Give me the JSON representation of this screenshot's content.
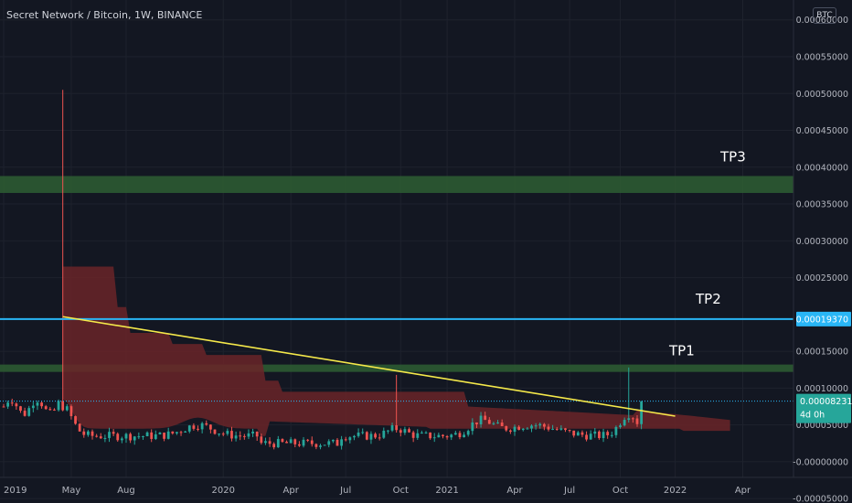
{
  "header": {
    "title": "Secret Network / Bitcoin, 1W, BINANCE",
    "currency": "BTC"
  },
  "chart_data": {
    "type": "candlestick",
    "yaxis": {
      "range": [
        -5.6e-05,
        0.000627
      ],
      "ticks": [
        "0.00060000",
        "0.00055000",
        "0.00050000",
        "0.00045000",
        "0.00040000",
        "0.00035000",
        "0.00030000",
        "0.00025000",
        "0.00015000",
        "0.00010000",
        "0.00005000",
        "-0.00000000",
        "-0.00005000"
      ],
      "tick_values": [
        0.0006,
        0.00055,
        0.0005,
        0.00045,
        0.0004,
        0.00035,
        0.0003,
        0.00025,
        0.00015,
        0.0001,
        5e-05,
        0,
        -5e-05
      ]
    },
    "xaxis": {
      "labels": [
        "2019",
        "May",
        "Aug",
        "2020",
        "Apr",
        "Jul",
        "Oct",
        "2021",
        "Apr",
        "Jul",
        "Oct",
        "2022",
        "Apr"
      ],
      "label_weeks": [
        0,
        16,
        29,
        52,
        68,
        81,
        94,
        105,
        121,
        134,
        146,
        159,
        175
      ]
    },
    "price_labels": {
      "tp2_price": "0.00019370",
      "last_price": "0.00008231",
      "countdown": "4d 0h"
    },
    "zones": [
      {
        "label": "TP3",
        "low": 0.000365,
        "high": 0.000388
      },
      {
        "label": "TP1",
        "low": 0.000122,
        "high": 0.000132
      }
    ],
    "levels": [
      {
        "label": "TP2",
        "value": 0.0001937
      }
    ],
    "dotted_level": 8.231e-05,
    "trendline": {
      "from": [
        14,
        0.000197
      ],
      "to": [
        159,
        6.2e-05
      ]
    },
    "colors": {
      "bg": "#131722",
      "grid": "#1e222d",
      "up": "#26a69a",
      "down": "#ef5350",
      "zone": "#2e5e32",
      "level": "#29b6f6",
      "trend": "#f5e94a",
      "cloud": "#6a2428",
      "text": "#d1d4dc",
      "axis_text": "#b2b5be",
      "last_bg": "#26a69a"
    }
  }
}
